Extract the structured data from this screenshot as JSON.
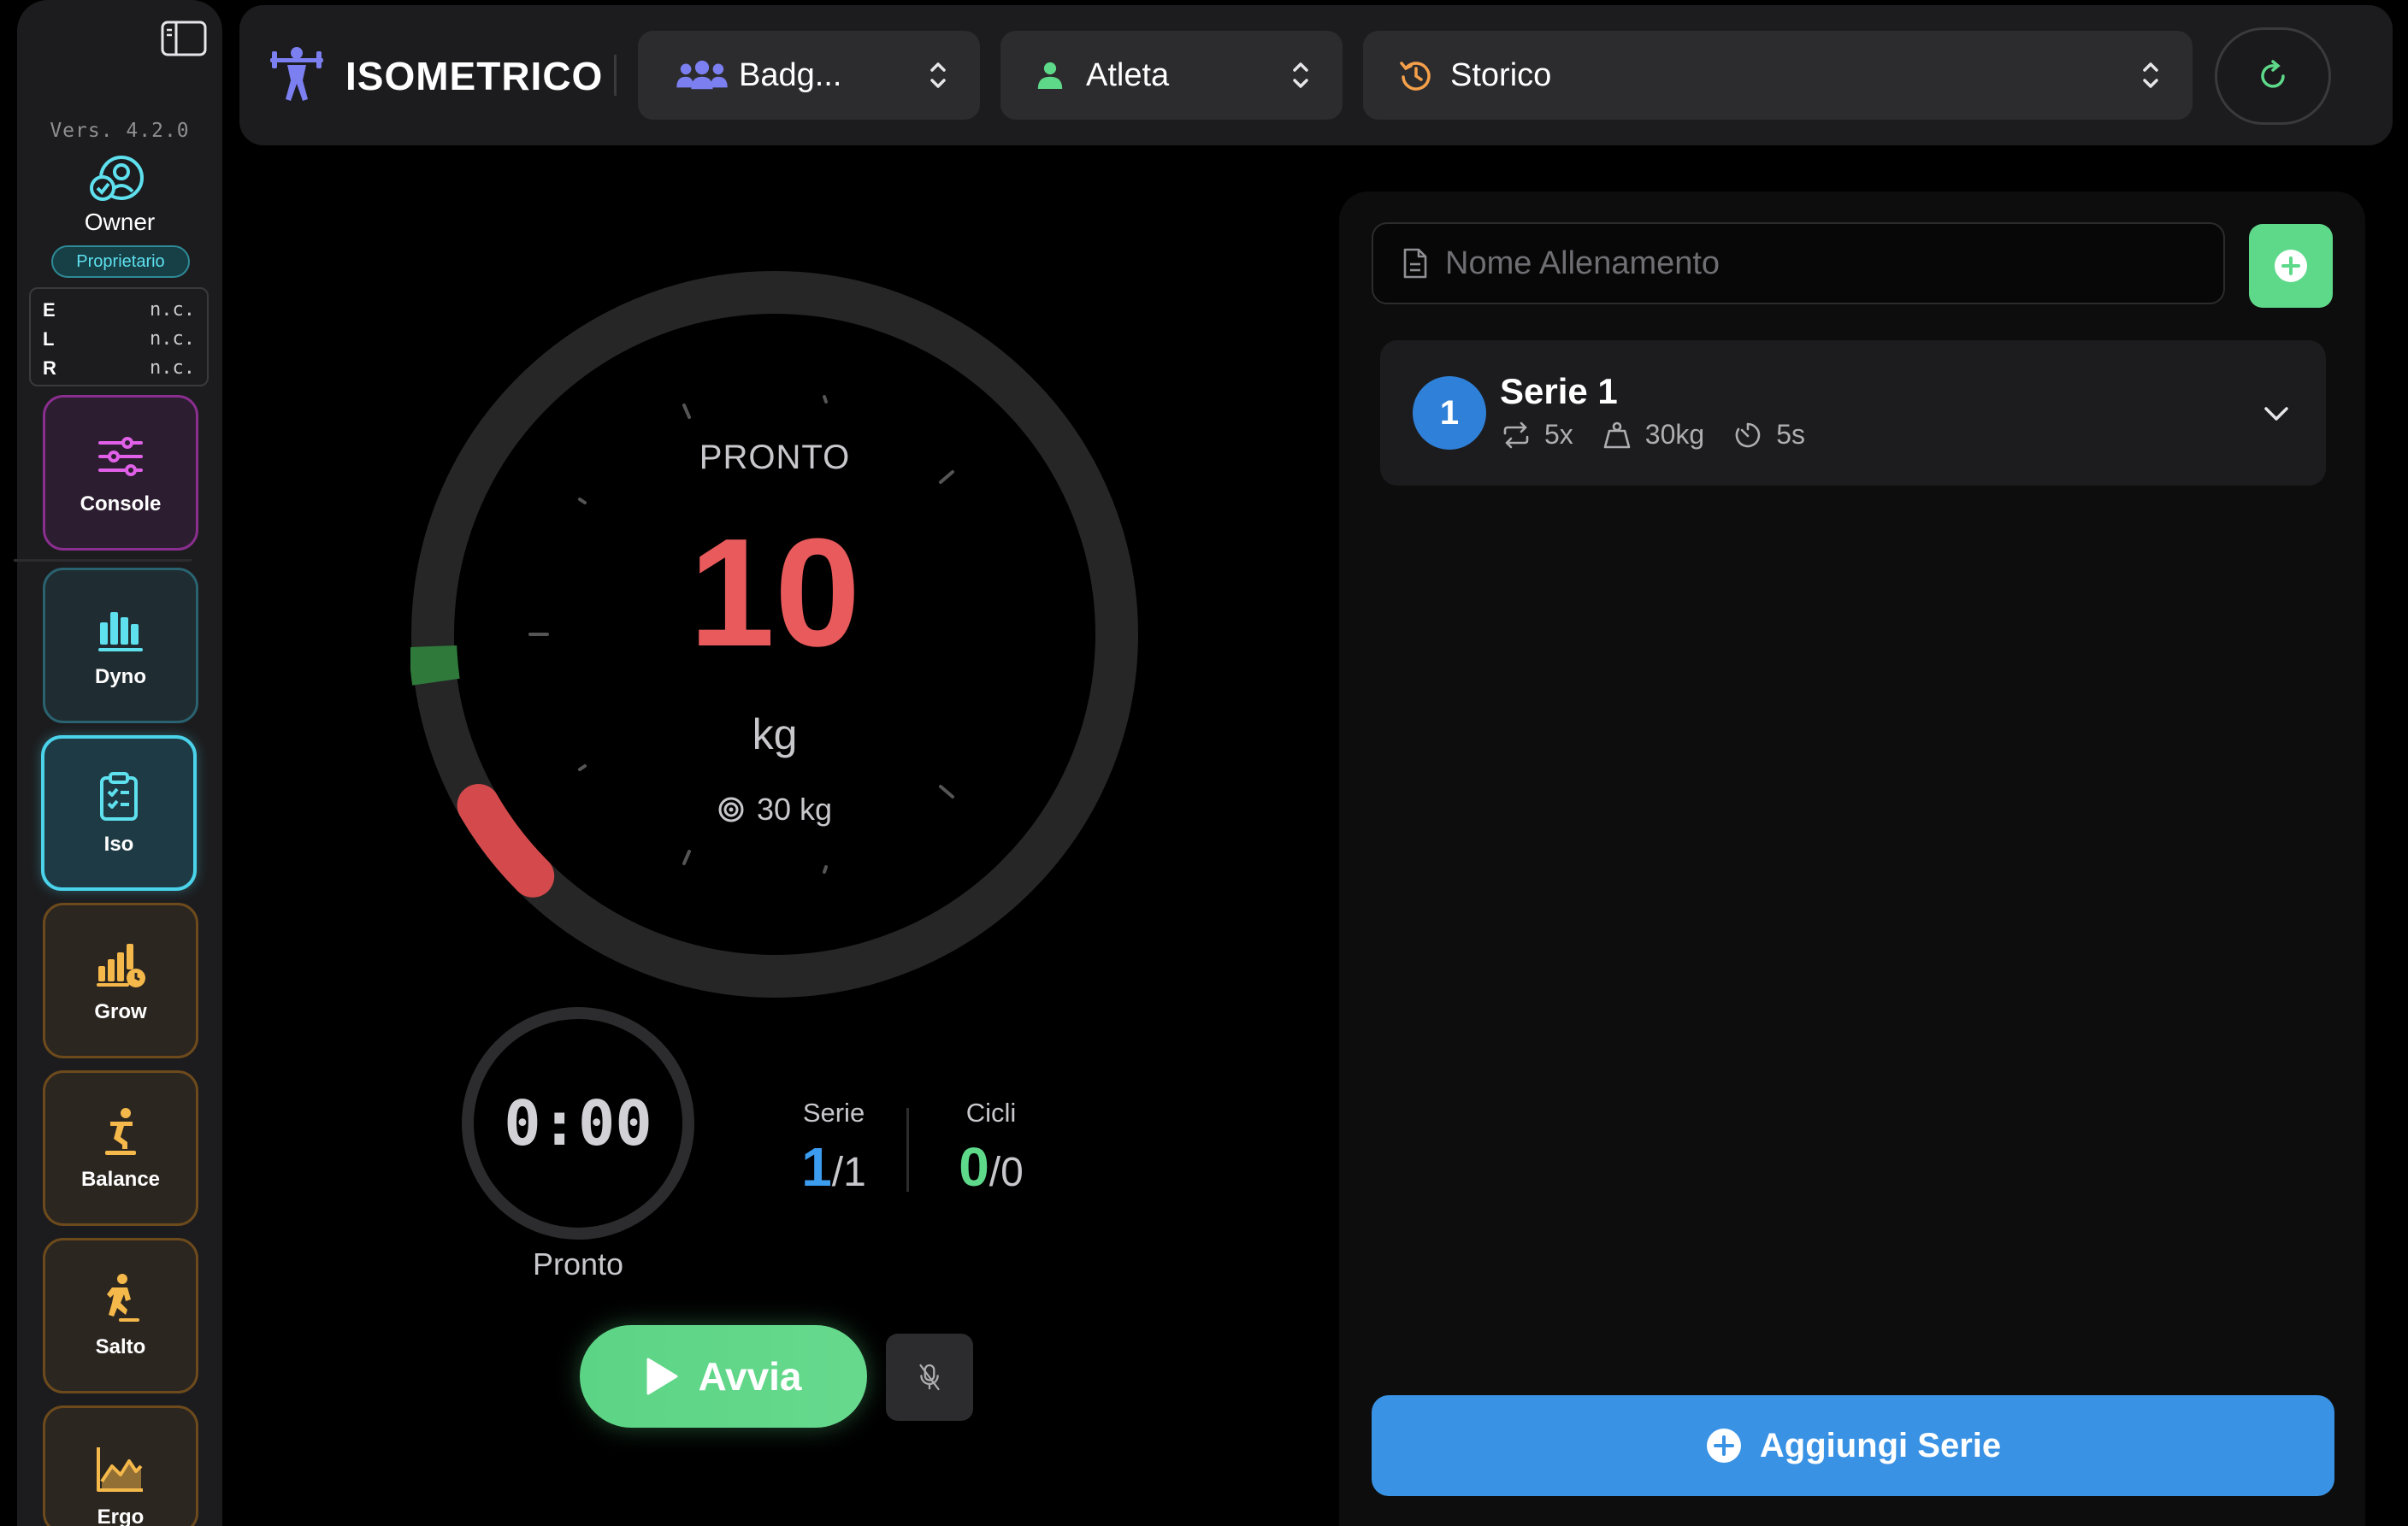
{
  "sidebar": {
    "version": "Vers. 4.2.0",
    "user_name": "Owner",
    "role_badge": "Proprietario",
    "elr": [
      {
        "key": "E",
        "value": "n.c."
      },
      {
        "key": "L",
        "value": "n.c."
      },
      {
        "key": "R",
        "value": "n.c."
      }
    ],
    "nav": {
      "console": "Console",
      "dyno": "Dyno",
      "iso": "Iso",
      "grow": "Grow",
      "balance": "Balance",
      "salto": "Salto",
      "ergo": "Ergo"
    },
    "active_item": "iso"
  },
  "header": {
    "app_title": "ISOMETRICO",
    "group_select": "Badg...",
    "athlete_select": "Atleta",
    "history_select": "Storico"
  },
  "gauge": {
    "status": "PRONTO",
    "value": "10",
    "unit": "kg",
    "target": "30 kg",
    "target_zone_color": "#2f7a3a",
    "current_zone_color": "#d44a4c"
  },
  "timer": {
    "time": "0:00",
    "status": "Pronto"
  },
  "counters": {
    "serie_label": "Serie",
    "serie_current": "1",
    "serie_total": "/1",
    "cicli_label": "Cicli",
    "cicli_current": "0",
    "cicli_total": "/0"
  },
  "actions": {
    "start_label": "Avvia"
  },
  "workout": {
    "name_placeholder": "Nome Allenamento",
    "name_value": "",
    "series": [
      {
        "number": "1",
        "title": "Serie 1",
        "reps": "5x",
        "weight": "30kg",
        "duration": "5s"
      }
    ],
    "add_series_label": "Aggiungi Serie"
  },
  "colors": {
    "accent_blue": "#3a92e4",
    "accent_green": "#5ed98a",
    "accent_red": "#e85a5c",
    "accent_cyan": "#4ad3ea"
  }
}
